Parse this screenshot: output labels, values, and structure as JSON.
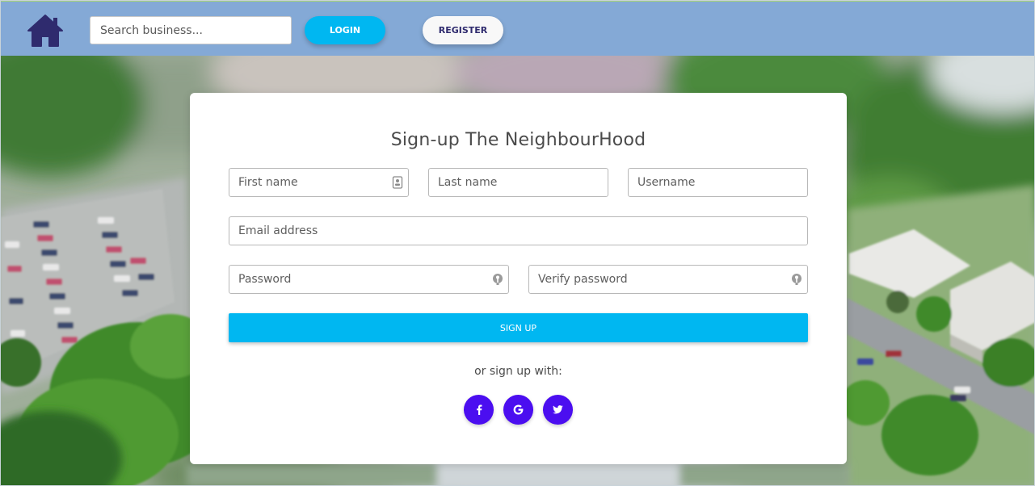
{
  "header": {
    "search_placeholder": "Search business...",
    "login_label": "LOGIN",
    "register_label": "REGISTER"
  },
  "form": {
    "title": "Sign-up The NeighbourHood",
    "first_name_placeholder": "First name",
    "last_name_placeholder": "Last name",
    "username_placeholder": "Username",
    "email_placeholder": "Email address",
    "password_placeholder": "Password",
    "verify_password_placeholder": "Verify password",
    "signup_label": "SIGN UP",
    "alt_signup_text": "or sign up with:"
  },
  "social": [
    {
      "icon": "facebook-icon"
    },
    {
      "icon": "google-icon"
    },
    {
      "icon": "twitter-icon"
    }
  ],
  "colors": {
    "navbar": "#84a9d6",
    "accent": "#00b7f1",
    "social": "#4b0ef0",
    "home_icon": "#2f2b6e"
  }
}
